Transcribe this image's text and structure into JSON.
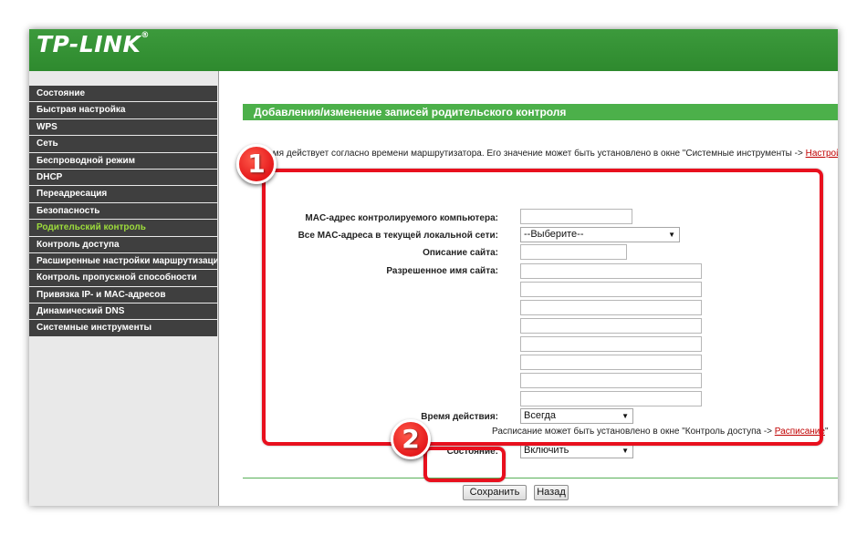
{
  "brand": {
    "logo_text": "TP-LINK",
    "reg_mark": "®"
  },
  "sidebar": {
    "items": [
      {
        "label": "Состояние"
      },
      {
        "label": "Быстрая настройка"
      },
      {
        "label": "WPS"
      },
      {
        "label": "Сеть"
      },
      {
        "label": "Беспроводной режим"
      },
      {
        "label": "DHCP"
      },
      {
        "label": "Переадресация"
      },
      {
        "label": "Безопасность"
      },
      {
        "label": "Родительский контроль"
      },
      {
        "label": "Контроль доступа"
      },
      {
        "label": "Расширенные настройки маршрутизации"
      },
      {
        "label": "Контроль пропускной способности"
      },
      {
        "label": "Привязка IP- и MAC-адресов"
      },
      {
        "label": "Динамический DNS"
      },
      {
        "label": "Системные инструменты"
      }
    ],
    "active_index": 8
  },
  "main": {
    "title": "Добавления/изменение записей родительского контроля",
    "info_text": "Время действует согласно времени маршрутизатора. Его значение может быть установлено в окне \"Системные инструменты -> ",
    "info_link": "Настройки времени",
    "form": {
      "mac_label": "MAC-адрес контролируемого компьютера:",
      "mac_value": "",
      "all_mac_label": "Все MAC-адреса в текущей локальной сети:",
      "all_mac_value": "--Выберите--",
      "site_desc_label": "Описание сайта:",
      "site_desc_value": "",
      "allowed_site_label": "Разрешенное имя сайта:",
      "allowed_sites": [
        "",
        "",
        "",
        "",
        "",
        "",
        "",
        ""
      ],
      "time_label": "Время действия:",
      "time_value": "Всегда",
      "schedule_note": "Расписание может быть установлено в окне \"Контроль доступа -> ",
      "schedule_link": "Расписание",
      "schedule_end": "\"",
      "status_label": "Состояние:",
      "status_value": "Включить"
    },
    "buttons": {
      "save": "Сохранить",
      "back": "Назад"
    }
  },
  "annotations": {
    "badge1": "1",
    "badge2": "2"
  },
  "colors": {
    "header_green": "#2e8a2e",
    "title_green": "#4cb04a",
    "sidebar_dark": "#3f3f3f",
    "active_item": "#9ddc3c",
    "highlight_red": "#e8101e",
    "link_red": "#c00000"
  }
}
